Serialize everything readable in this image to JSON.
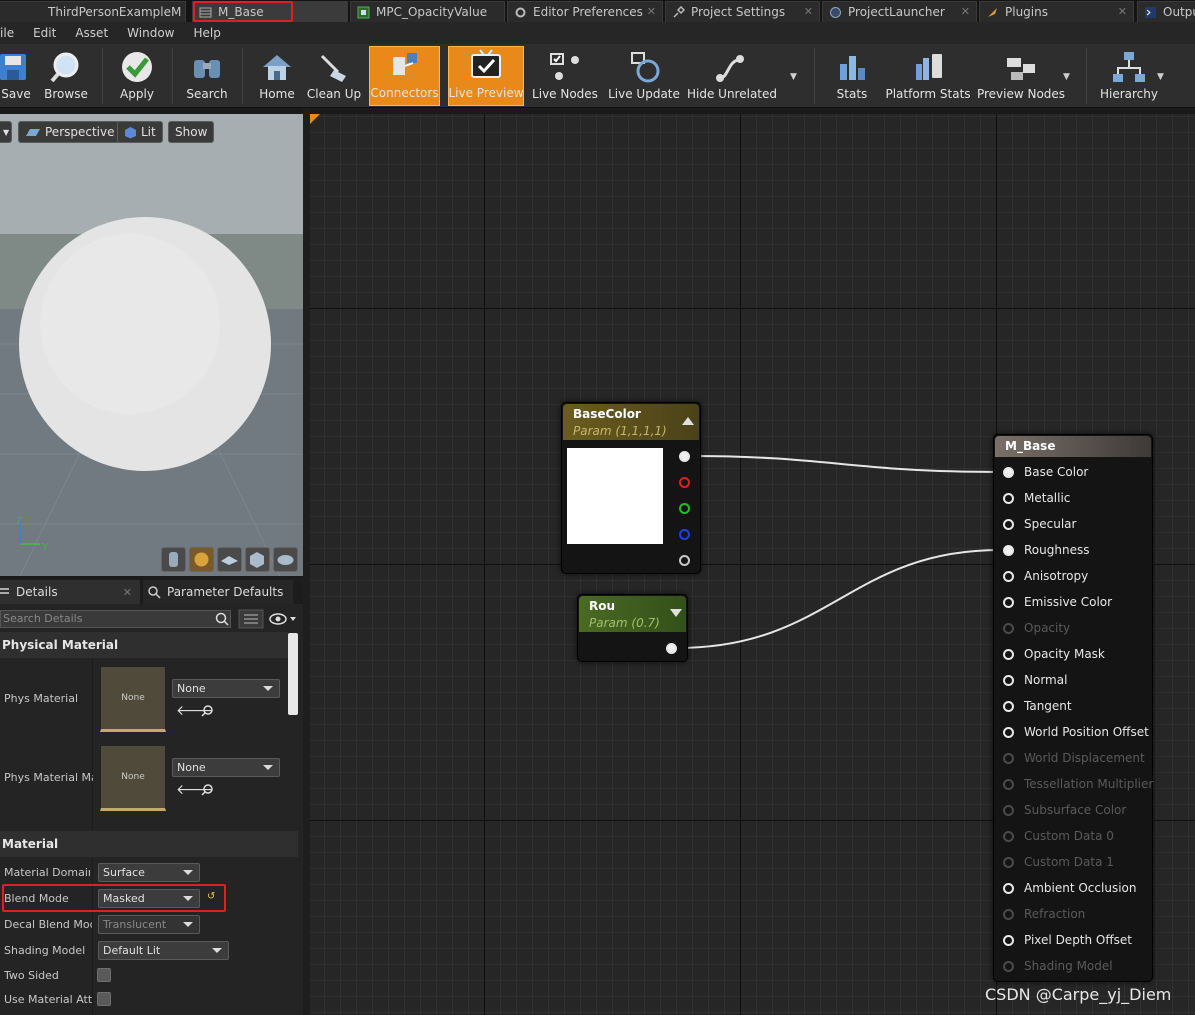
{
  "tabs": [
    {
      "label": "ThirdPersonExampleM",
      "icon": "level-icon"
    },
    {
      "label": "M_Base",
      "icon": "material-icon"
    },
    {
      "label": "MPC_OpacityValue",
      "icon": "parameter-collection-icon"
    },
    {
      "label": "Editor Preferences",
      "icon": "preferences-icon"
    },
    {
      "label": "Project Settings",
      "icon": "settings-icon"
    },
    {
      "label": "ProjectLauncher",
      "icon": "launcher-icon"
    },
    {
      "label": "Plugins",
      "icon": "plugin-icon"
    },
    {
      "label": "Outpu",
      "icon": "output-icon"
    }
  ],
  "menu": [
    "File",
    "Edit",
    "Asset",
    "Window",
    "Help"
  ],
  "toolbar": {
    "save": "Save",
    "browse": "Browse",
    "apply": "Apply",
    "search": "Search",
    "home": "Home",
    "clean_up": "Clean Up",
    "connectors": "Connectors",
    "live_preview": "Live Preview",
    "live_nodes": "Live Nodes",
    "live_update": "Live Update",
    "hide_unrelated": "Hide Unrelated",
    "stats": "Stats",
    "platform_stats": "Platform Stats",
    "preview_nodes": "Preview Nodes",
    "hierarchy": "Hierarchy"
  },
  "viewport": {
    "perspective": "Perspective",
    "lit": "Lit",
    "show": "Show",
    "axis_z": "Z",
    "axis_y": "Y"
  },
  "details": {
    "tab_details": "Details",
    "tab_params": "Parameter Defaults",
    "search_placeholder": "Search Details",
    "physical_material_header": "Physical Material",
    "phys_material_label": "Phys Material",
    "phys_material_thumb": "None",
    "phys_material_value": "None",
    "phys_material_mask_label": "Phys Material Mask",
    "phys_material_mask_thumb": "None",
    "phys_material_mask_value": "None",
    "material_header": "Material",
    "material_domain_label": "Material Domain",
    "material_domain_value": "Surface",
    "blend_mode_label": "Blend Mode",
    "blend_mode_value": "Masked",
    "decal_blend_label": "Decal Blend Mode",
    "decal_blend_value": "Translucent",
    "shading_model_label": "Shading Model",
    "shading_model_value": "Default Lit",
    "two_sided_label": "Two Sided",
    "use_material_attr_label": "Use Material Attributes"
  },
  "graph": {
    "basecolor_node": {
      "title": "BaseColor",
      "subtitle": "Param (1,1,1,1)"
    },
    "rou_node": {
      "title": "Rou",
      "subtitle": "Param (0.7)"
    },
    "result_node": {
      "title": "M_Base",
      "inputs": [
        {
          "label": "Base Color",
          "enabled": true
        },
        {
          "label": "Metallic",
          "enabled": true
        },
        {
          "label": "Specular",
          "enabled": true
        },
        {
          "label": "Roughness",
          "enabled": true
        },
        {
          "label": "Anisotropy",
          "enabled": true
        },
        {
          "label": "Emissive Color",
          "enabled": true
        },
        {
          "label": "Opacity",
          "enabled": false
        },
        {
          "label": "Opacity Mask",
          "enabled": true
        },
        {
          "label": "Normal",
          "enabled": true
        },
        {
          "label": "Tangent",
          "enabled": true
        },
        {
          "label": "World Position Offset",
          "enabled": true
        },
        {
          "label": "World Displacement",
          "enabled": false
        },
        {
          "label": "Tessellation Multiplier",
          "enabled": false
        },
        {
          "label": "Subsurface Color",
          "enabled": false
        },
        {
          "label": "Custom Data 0",
          "enabled": false
        },
        {
          "label": "Custom Data 1",
          "enabled": false
        },
        {
          "label": "Ambient Occlusion",
          "enabled": true
        },
        {
          "label": "Refraction",
          "enabled": false
        },
        {
          "label": "Pixel Depth Offset",
          "enabled": true
        },
        {
          "label": "Shading Model",
          "enabled": false
        }
      ]
    }
  },
  "watermark": "CSDN @Carpe_yj_Diem",
  "colors": {
    "accent_orange": "#e8891a",
    "highlight_red": "#e02020",
    "basecolor_header": "#6b5d1e",
    "rou_header": "#4a6a22"
  }
}
